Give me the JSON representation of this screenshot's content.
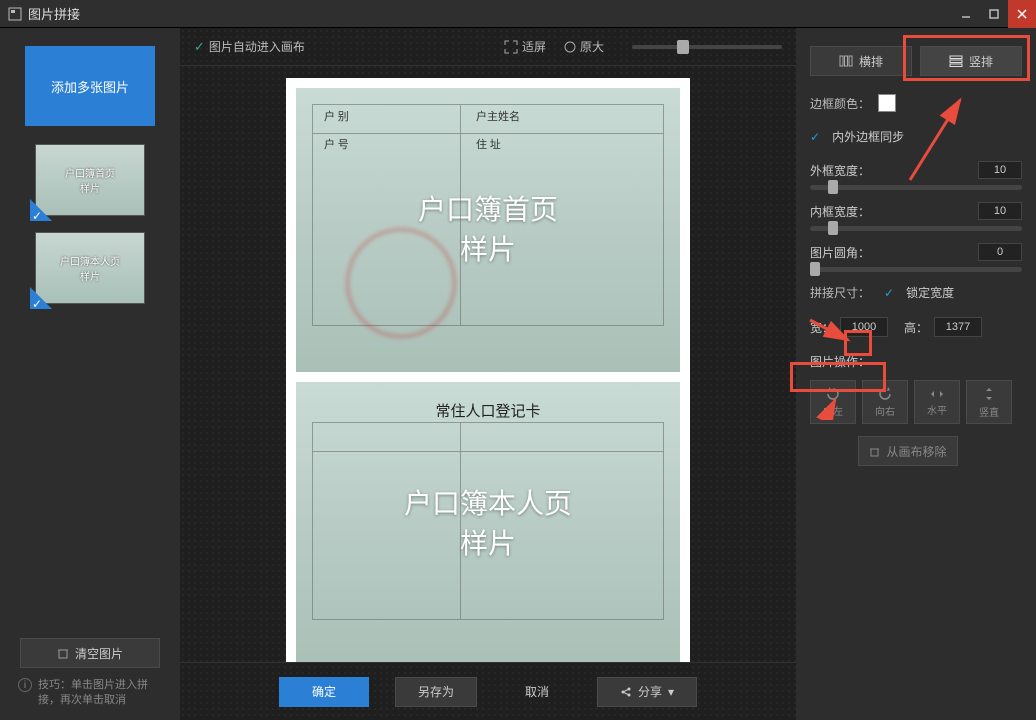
{
  "titlebar": {
    "title": "图片拼接"
  },
  "left": {
    "add_button": "添加多张图片",
    "thumb1_line1": "户口簿首页",
    "thumb1_line2": "样片",
    "thumb2_line1": "户口簿本人页",
    "thumb2_line2": "样片",
    "clear_button": "清空图片",
    "tip_text": "技巧：单击图片进入拼接，再次单击取消"
  },
  "center": {
    "auto_enter": "图片自动进入画布",
    "fit": "适屏",
    "original": "原大",
    "doc1_line1": "户口簿首页",
    "doc1_line2": "样片",
    "doc2_title": "常住人口登记卡",
    "doc2_line1": "户口簿本人页",
    "doc2_line2": "样片",
    "doc1_f1": "户 别",
    "doc1_f2": "户主姓名",
    "doc1_f3": "户 号",
    "doc1_f4": "住 址",
    "ok": "确定",
    "save_as": "另存为",
    "cancel": "取消",
    "share": "分享"
  },
  "right": {
    "layout_h": "横排",
    "layout_v": "竖排",
    "border_color": "边框颜色：",
    "sync_border": "内外边框同步",
    "outer_width": "外框宽度：",
    "outer_width_val": "10",
    "inner_width": "内框宽度：",
    "inner_width_val": "10",
    "radius": "图片圆角：",
    "radius_val": "0",
    "stitch_size": "拼接尺寸：",
    "lock_width": "锁定宽度",
    "width_label": "宽：",
    "width_val": "1000",
    "height_label": "高：",
    "height_val": "1377",
    "ops_label": "图片操作：",
    "op_left": "向左",
    "op_right": "向右",
    "op_hflip": "水平",
    "op_vflip": "竖直",
    "remove": "从画布移除"
  }
}
